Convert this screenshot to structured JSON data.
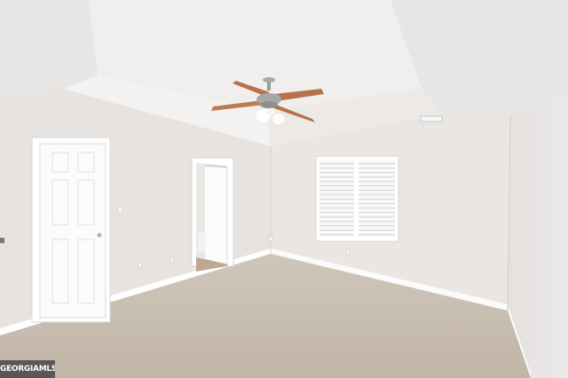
{
  "scene": {
    "description_label": "empty-bedroom-photo",
    "colors": {
      "wall": "#e9e6e4",
      "wall_shadow": "#dedad8",
      "ceiling": "#f1efed",
      "carpet": "#c9bfb3",
      "trim": "#ffffff",
      "fan_blade": "#b9714a",
      "fan_metal": "#9a9a9a"
    }
  },
  "watermark": {
    "text": "GEORGIAMLS"
  }
}
